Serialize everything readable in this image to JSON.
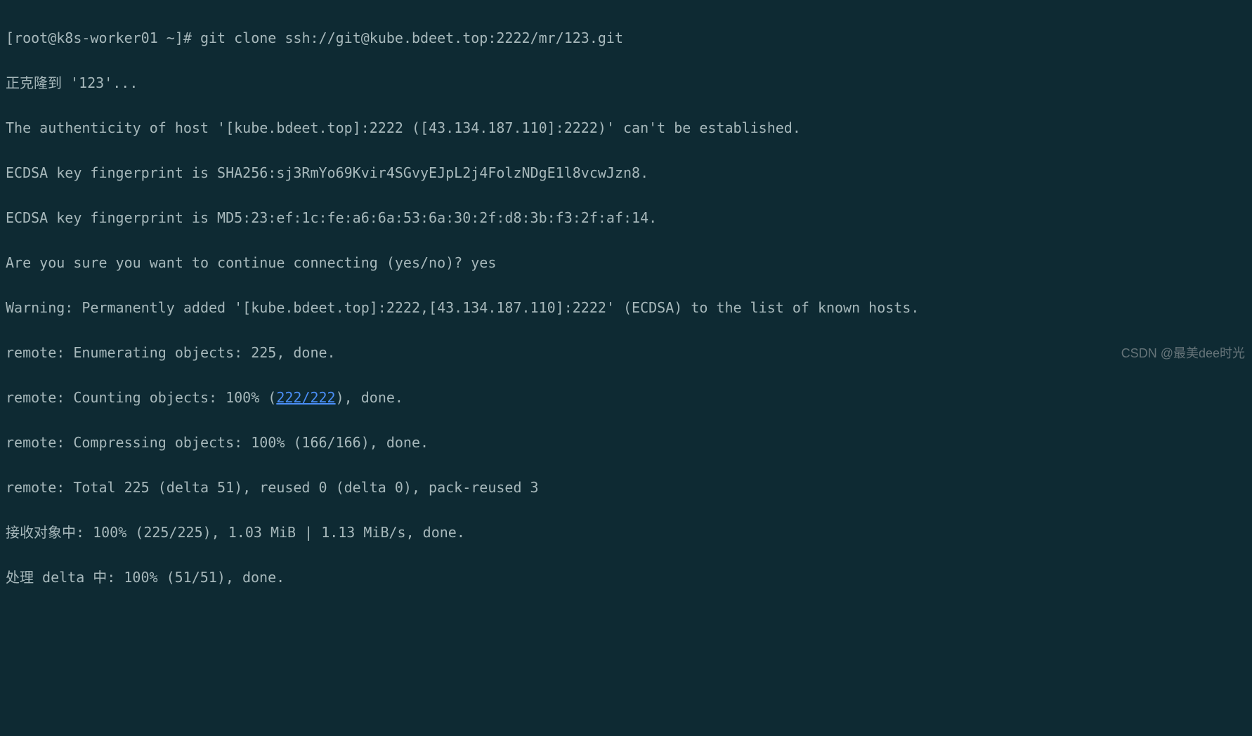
{
  "lines": {
    "0": {
      "prompt": "[root@k8s-worker01 ~]# ",
      "command": "git clone ssh://git@kube.bdeet.top:2222/mr/123.git"
    },
    "1": "正克隆到 '123'...",
    "2": "The authenticity of host '[kube.bdeet.top]:2222 ([43.134.187.110]:2222)' can't be established.",
    "3": "ECDSA key fingerprint is SHA256:sj3RmYo69Kvir4SGvyEJpL2j4FolzNDgE1l8vcwJzn8.",
    "4": "ECDSA key fingerprint is MD5:23:ef:1c:fe:a6:6a:53:6a:30:2f:d8:3b:f3:2f:af:14.",
    "5": {
      "question": "Are you sure you want to continue connecting (yes/no)? ",
      "answer": "yes"
    },
    "6": "Warning: Permanently added '[kube.bdeet.top]:2222,[43.134.187.110]:2222' (ECDSA) to the list of known hosts.",
    "7": "remote: Enumerating objects: 225, done.",
    "8": {
      "prefix": "remote: Counting objects: 100% (",
      "link": "222/222",
      "suffix": "), done."
    },
    "9": "remote: Compressing objects: 100% (166/166), done.",
    "10": "remote: Total 225 (delta 51), reused 0 (delta 0), pack-reused 3",
    "11": "接收对象中: 100% (225/225), 1.03 MiB | 1.13 MiB/s, done.",
    "12": "处理 delta 中: 100% (51/51), done."
  },
  "watermark": "CSDN @最美dee时光"
}
